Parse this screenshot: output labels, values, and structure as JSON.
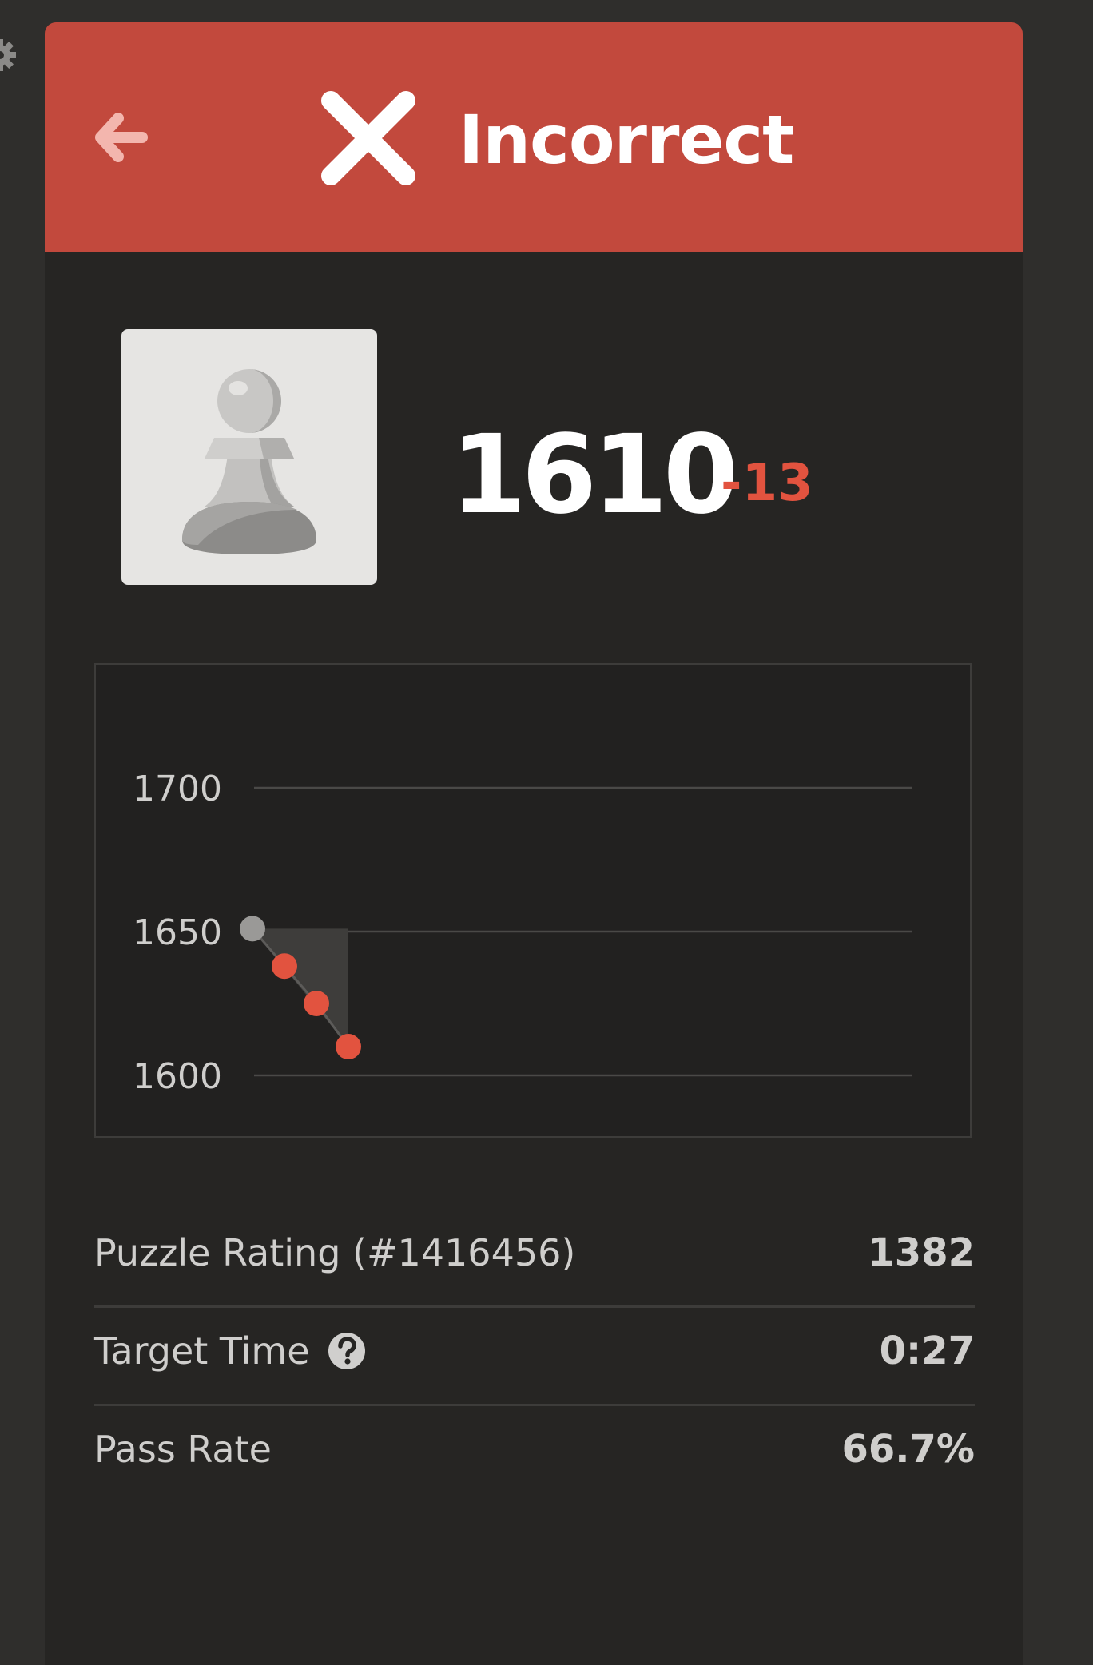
{
  "header": {
    "title": "Incorrect",
    "back_icon": "arrow-left-icon",
    "status_icon": "x-icon",
    "background_color": "#c2493d"
  },
  "player": {
    "avatar_icon": "pawn-icon",
    "rating": "1610",
    "rating_change": "-13",
    "rating_change_color": "#e2533f"
  },
  "chart_data": {
    "type": "line",
    "title": "",
    "xlabel": "",
    "ylabel": "",
    "ylim": [
      1590,
      1710
    ],
    "yticks": [
      1600,
      1650,
      1700
    ],
    "grid": true,
    "x": [
      0,
      1,
      2,
      3
    ],
    "series": [
      {
        "values": [
          1651,
          1638,
          1625,
          1610
        ],
        "point_colors": [
          "#9a9997",
          "#e2533f",
          "#e2533f",
          "#e2533f"
        ]
      }
    ]
  },
  "stats": [
    {
      "label": "Puzzle Rating (#1416456)",
      "value": "1382",
      "has_help_icon": false
    },
    {
      "label": "Target Time",
      "value": "0:27",
      "has_help_icon": true
    },
    {
      "label": "Pass Rate",
      "value": "66.7%",
      "has_help_icon": false
    }
  ],
  "icons": {
    "settings": "gear-icon",
    "help": "question-circle-icon"
  }
}
